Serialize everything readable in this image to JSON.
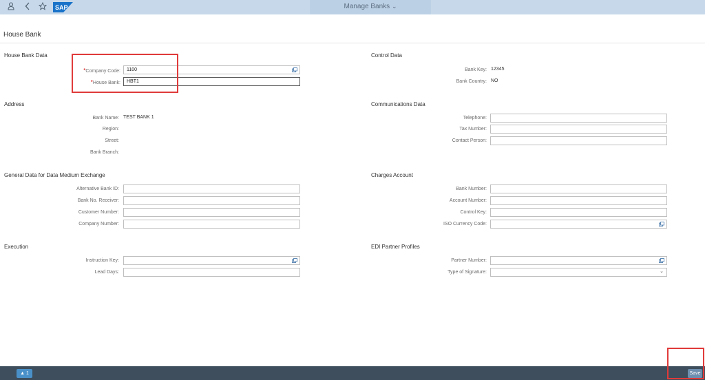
{
  "shell": {
    "title": "Manage Banks",
    "logo_text": "SAP",
    "icons": [
      "user-icon",
      "back-icon",
      "home-icon",
      "chevron-down-icon"
    ]
  },
  "page": {
    "title": "House Bank"
  },
  "sections": {
    "house_bank_data": {
      "title": "House Bank Data",
      "company_code": {
        "label": "Company Code:",
        "value": "1100",
        "required": "*"
      },
      "house_bank": {
        "label": "House Bank:",
        "value": "HBT1",
        "required": "*"
      }
    },
    "control_data": {
      "title": "Control Data",
      "bank_key": {
        "label": "Bank Key:",
        "value": "12345"
      },
      "bank_country": {
        "label": "Bank Country:",
        "value": "NO"
      }
    },
    "address": {
      "title": "Address",
      "bank_name": {
        "label": "Bank Name:",
        "value": "TEST BANK 1"
      },
      "region": {
        "label": "Region:",
        "value": ""
      },
      "street": {
        "label": "Street:",
        "value": ""
      },
      "bank_branch": {
        "label": "Bank Branch:",
        "value": ""
      }
    },
    "communications": {
      "title": "Communications Data",
      "telephone": {
        "label": "Telephone:",
        "value": ""
      },
      "tax_number": {
        "label": "Tax Number:",
        "value": ""
      },
      "contact_person": {
        "label": "Contact Person:",
        "value": ""
      }
    },
    "medium_exchange": {
      "title": "General Data for Data Medium Exchange",
      "alt_bank_id": {
        "label": "Alternative Bank ID:",
        "value": ""
      },
      "bank_no_receiver": {
        "label": "Bank No. Receiver:",
        "value": ""
      },
      "customer_number": {
        "label": "Customer Number:",
        "value": ""
      },
      "company_number": {
        "label": "Company Number:",
        "value": ""
      }
    },
    "charges": {
      "title": "Charges Account",
      "bank_number": {
        "label": "Bank Number:",
        "value": ""
      },
      "account_number": {
        "label": "Account Number:",
        "value": ""
      },
      "control_key": {
        "label": "Control Key:",
        "value": ""
      },
      "iso_currency": {
        "label": "ISO Currency Code:",
        "value": ""
      }
    },
    "execution": {
      "title": "Execution",
      "instruction_key": {
        "label": "Instruction Key:",
        "value": ""
      },
      "lead_days": {
        "label": "Lead Days:",
        "value": ""
      }
    },
    "edi": {
      "title": "EDI Partner Profiles",
      "partner_number": {
        "label": "Partner Number:",
        "value": ""
      },
      "signature_type": {
        "label": "Type of Signature:",
        "value": ""
      }
    }
  },
  "footer": {
    "message_count": "1",
    "save_label": "Save"
  },
  "colors": {
    "shell": "#c7d8ea",
    "footer": "#3e4e5c",
    "highlight": "#e03a3a",
    "required": "#d40000"
  }
}
